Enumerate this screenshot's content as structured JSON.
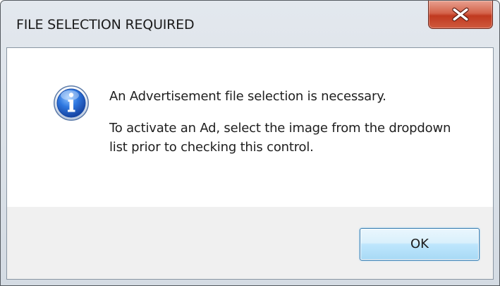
{
  "window": {
    "title": "FILE SELECTION REQUIRED"
  },
  "titlebar_controls": {
    "close_icon": "close-icon",
    "close_color": "#c7432a"
  },
  "dialog": {
    "icon": "info-icon",
    "icon_color": "#1f5fbf",
    "message_main": "An Advertisement file selection is necessary.",
    "message_detail": "To activate an Ad, select the image from the dropdown list prior to checking this control."
  },
  "buttons": {
    "ok_label": "OK"
  }
}
